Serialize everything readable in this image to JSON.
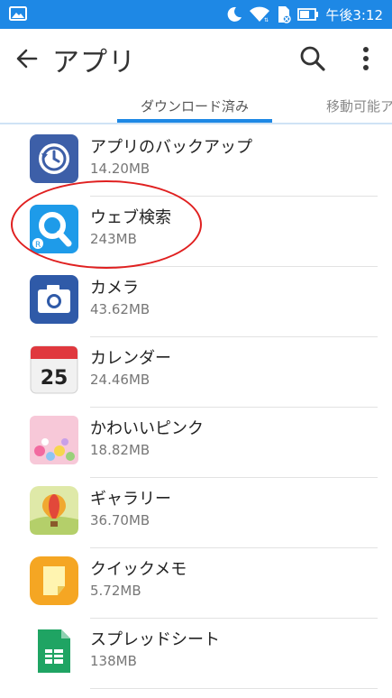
{
  "status_bar": {
    "time": "午後3:12",
    "icons": [
      "image-icon",
      "moon-icon",
      "wifi-icon",
      "sim-icon",
      "battery-icon"
    ]
  },
  "app_bar": {
    "title": "アプリ",
    "back_icon": "back-arrow-icon",
    "search_icon": "search-icon",
    "more_icon": "more-vert-icon"
  },
  "tabs": [
    {
      "label": "ダウンロード済み",
      "selected": true
    },
    {
      "label": "移動可能ア",
      "selected": false
    }
  ],
  "apps": [
    {
      "name": "アプリのバックアップ",
      "size": "14.20MB",
      "icon": "backup-icon"
    },
    {
      "name": "ウェブ検索",
      "size": "243MB",
      "icon": "web-search-icon",
      "highlighted": true
    },
    {
      "name": "カメラ",
      "size": "43.62MB",
      "icon": "camera-icon"
    },
    {
      "name": "カレンダー",
      "size": "24.46MB",
      "icon": "calendar-icon",
      "icon_text": "25"
    },
    {
      "name": "かわいいピンク",
      "size": "18.82MB",
      "icon": "pink-theme-icon"
    },
    {
      "name": "ギャラリー",
      "size": "36.70MB",
      "icon": "gallery-icon"
    },
    {
      "name": "クイックメモ",
      "size": "5.72MB",
      "icon": "quick-memo-icon"
    },
    {
      "name": "スプレッドシート",
      "size": "138MB",
      "icon": "sheets-icon"
    }
  ],
  "colors": {
    "status_bar": "#1e88e5",
    "accent": "#1e88e5",
    "annotation": "#e02020"
  }
}
